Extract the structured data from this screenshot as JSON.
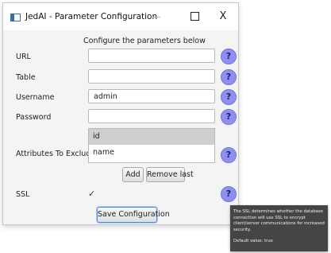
{
  "window": {
    "title": "JedAI - Parameter Configuration",
    "minimize_glyph": "",
    "close_glyph": "X"
  },
  "form": {
    "heading": "Configure the parameters below",
    "labels": {
      "url": "URL",
      "table": "Table",
      "username": "Username",
      "password": "Password",
      "attributes": "Attributes To Exclude",
      "ssl": "SSL"
    },
    "values": {
      "url": "",
      "table": "",
      "username": "admin",
      "password": ""
    },
    "help_glyph": "?",
    "attributes_list": [
      {
        "label": "id",
        "selected": true
      },
      {
        "label": "name",
        "selected": false
      }
    ],
    "add_button": "Add",
    "remove_button": "Remove last",
    "ssl_checked": true,
    "ssl_check_glyph": "✓",
    "save_button": "Save Configuration"
  },
  "tooltip": {
    "text": "The SSL determines whether the database connection will use SSL to encrypt client/server communications for increased security.",
    "default_value": "Default value: true"
  },
  "colors": {
    "help_button": "#8f8ff0",
    "tooltip_bg": "#454545",
    "focus_border": "#4f8ed8"
  }
}
